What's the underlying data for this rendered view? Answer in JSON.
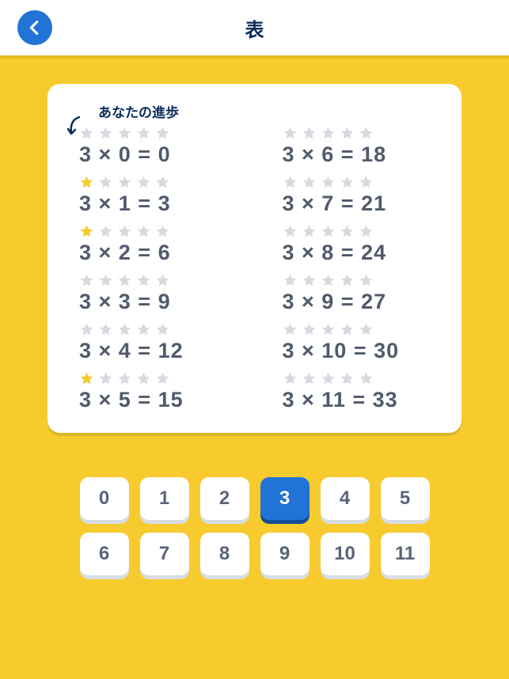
{
  "header": {
    "title": "表"
  },
  "card": {
    "progress_label": "あなたの進歩",
    "entries": [
      {
        "stars": 0,
        "a": 3,
        "b": 0,
        "result": 0
      },
      {
        "stars": 0,
        "a": 3,
        "b": 6,
        "result": 18
      },
      {
        "stars": 1,
        "a": 3,
        "b": 1,
        "result": 3
      },
      {
        "stars": 0,
        "a": 3,
        "b": 7,
        "result": 21
      },
      {
        "stars": 1,
        "a": 3,
        "b": 2,
        "result": 6
      },
      {
        "stars": 0,
        "a": 3,
        "b": 8,
        "result": 24
      },
      {
        "stars": 0,
        "a": 3,
        "b": 3,
        "result": 9
      },
      {
        "stars": 0,
        "a": 3,
        "b": 9,
        "result": 27
      },
      {
        "stars": 0,
        "a": 3,
        "b": 4,
        "result": 12
      },
      {
        "stars": 0,
        "a": 3,
        "b": 10,
        "result": 30
      },
      {
        "stars": 1,
        "a": 3,
        "b": 5,
        "result": 15
      },
      {
        "stars": 0,
        "a": 3,
        "b": 11,
        "result": 33
      }
    ]
  },
  "selector": {
    "buttons": [
      0,
      1,
      2,
      3,
      4,
      5,
      6,
      7,
      8,
      9,
      10,
      11
    ],
    "active": 3
  }
}
